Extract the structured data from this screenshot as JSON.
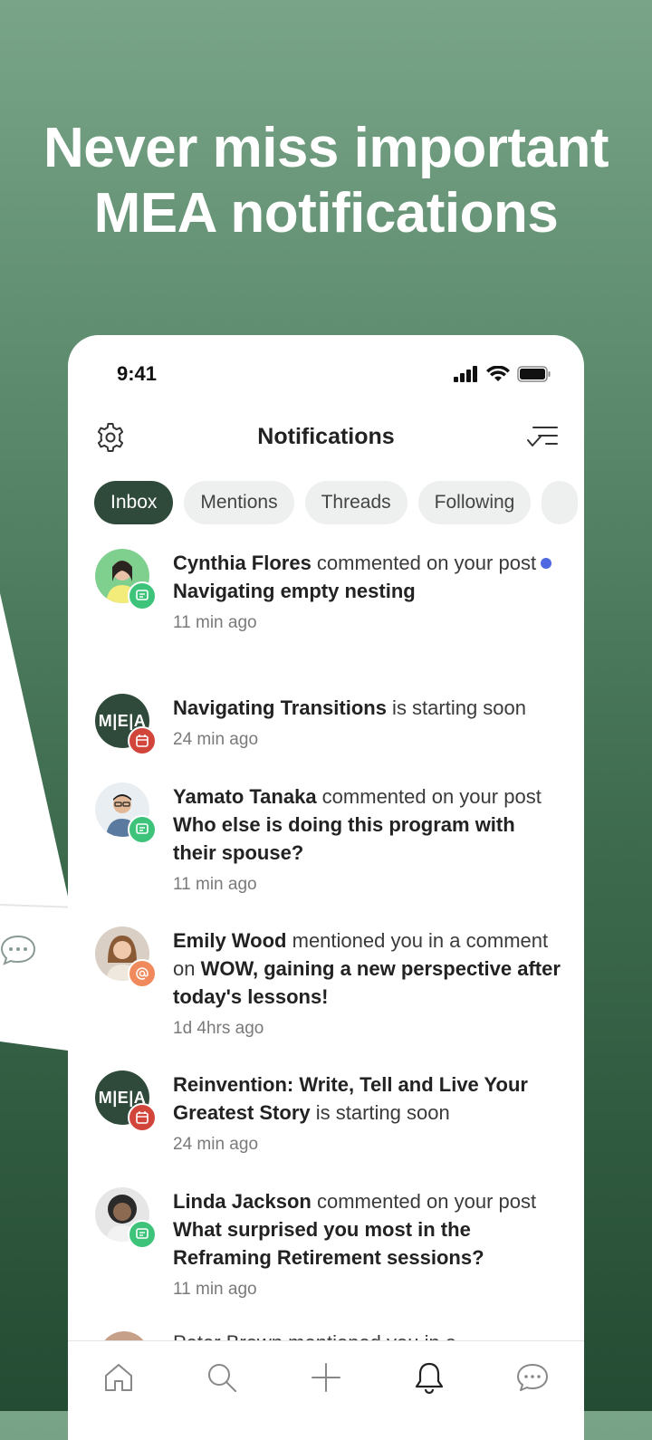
{
  "headline": {
    "line1": "Never miss important",
    "line2": "MEA notifications"
  },
  "status": {
    "time": "9:41"
  },
  "header": {
    "title": "Notifications"
  },
  "tabs": [
    {
      "label": "Inbox",
      "active": true
    },
    {
      "label": "Mentions",
      "active": false
    },
    {
      "label": "Threads",
      "active": false
    },
    {
      "label": "Following",
      "active": false
    }
  ],
  "notifications": [
    {
      "actor": "Cynthia Flores",
      "action": " commented on your post ",
      "target": "Navigating empty nesting",
      "time": "11 min ago",
      "badge": "comment",
      "unread": true
    },
    {
      "actor": "Navigating Transitions",
      "action": " is starting soon",
      "target": "",
      "time": "24 min ago",
      "badge": "event",
      "avatar_text": "M|E|A"
    },
    {
      "actor": "Yamato Tanaka",
      "action": " commented on your post ",
      "target": "Who else is doing this program with their spouse?",
      "time": "11 min ago",
      "badge": "comment"
    },
    {
      "actor": "Emily Wood",
      "action": " mentioned you in a comment on ",
      "target": "WOW, gaining a new perspective after today's lessons!",
      "time": "1d 4hrs ago",
      "badge": "mention"
    },
    {
      "actor": "Reinvention: Write, Tell and Live Your Greatest Story",
      "action": " is starting soon",
      "target": "",
      "time": "24 min ago",
      "badge": "event",
      "avatar_text": "M|E|A"
    },
    {
      "actor": "Linda Jackson",
      "action": " commented on your post ",
      "target": "What surprised you most in the Reframing Retirement sessions?",
      "time": "11 min ago",
      "badge": "comment"
    }
  ],
  "peek_text": "Peter Brown mentioned you in a",
  "colors": {
    "accent_dark": "#2f4a3a",
    "unread_dot": "#4d68e0",
    "badge_comment": "#3ec47a",
    "badge_event": "#d2453b",
    "badge_mention": "#f08a5d"
  },
  "bottom_nav": [
    "home-icon",
    "search-icon",
    "plus-icon",
    "bell-icon",
    "chat-icon"
  ]
}
